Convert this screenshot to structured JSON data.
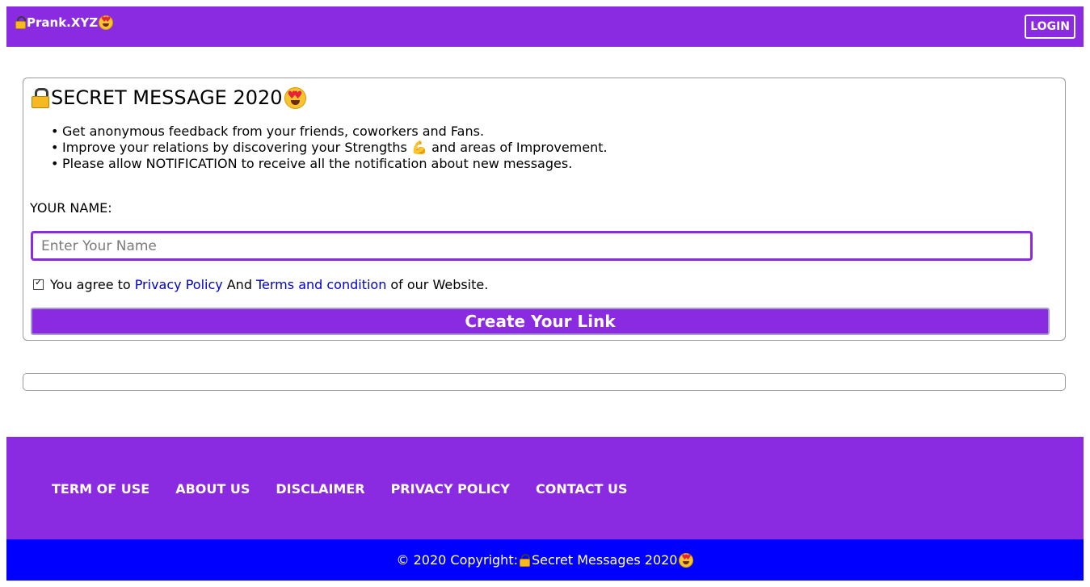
{
  "header": {
    "brand": "Prank.XYZ",
    "login_label": "LOGIN",
    "background": "#8a2be2"
  },
  "card": {
    "title": "SECRET MESSAGE 2020",
    "bullets": [
      "Get anonymous feedback from your friends, coworkers and Fans.",
      "Improve your relations by discovering your Strengths",
      "and areas of Improvement.",
      "Please allow NOTIFICATION to receive all the notification about new messages."
    ],
    "strength_icon": "flexed-biceps-emoji",
    "name_label": "YOUR NAME:",
    "name_input": {
      "placeholder": "Enter Your Name",
      "value": ""
    },
    "agree": {
      "prefix": "You agree to",
      "privacy_link": "Privacy Policy",
      "and": "And",
      "terms_link": "Terms and condition",
      "suffix": "of our Website.",
      "checked": true
    },
    "create_button": "Create Your Link"
  },
  "footer": {
    "links": [
      "TERM OF USE",
      "ABOUT US",
      "DISCLAIMER",
      "PRIVACY POLICY",
      "CONTACT US"
    ],
    "copyright_prefix": "© 2020 Copyright:",
    "copyright_name": "Secret Messages 2020",
    "background": "#8a2be2",
    "copyright_background": "#0000ff"
  },
  "icons": {
    "lock": "lock-emoji",
    "heart_eyes": "smiling-face-with-heart-eyes-emoji"
  }
}
